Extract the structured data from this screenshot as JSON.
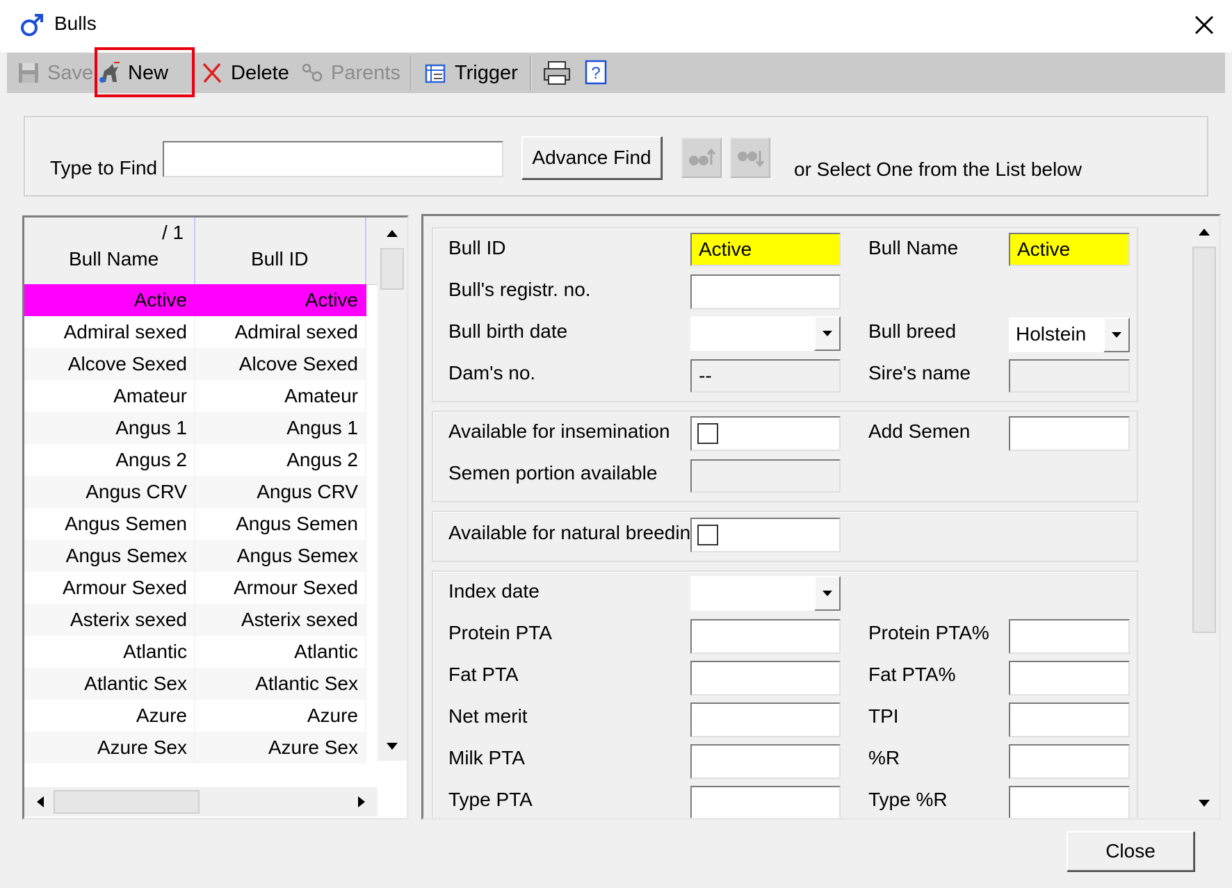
{
  "window": {
    "title": "Bulls",
    "close_glyph": "✕"
  },
  "toolbar": {
    "save": "Save",
    "new": "New",
    "delete": "Delete",
    "parents": "Parents",
    "trigger": "Trigger",
    "help_glyph": "?"
  },
  "find": {
    "label": "Type to Find",
    "value": "",
    "advance_find": "Advance Find",
    "hint": "or Select One from the List below"
  },
  "list": {
    "sort_indicator": "/ 1",
    "columns": [
      "Bull Name",
      "Bull ID"
    ],
    "rows": [
      [
        "Active",
        "Active"
      ],
      [
        "Admiral sexed",
        "Admiral sexed"
      ],
      [
        "Alcove Sexed",
        "Alcove Sexed"
      ],
      [
        "Amateur",
        "Amateur"
      ],
      [
        "Angus 1",
        "Angus 1"
      ],
      [
        "Angus 2",
        "Angus 2"
      ],
      [
        "Angus CRV",
        "Angus CRV"
      ],
      [
        "Angus Semen",
        "Angus Semen"
      ],
      [
        "Angus Semex",
        "Angus Semex"
      ],
      [
        "Armour Sexed",
        "Armour Sexed"
      ],
      [
        "Asterix sexed",
        "Asterix sexed"
      ],
      [
        "Atlantic",
        "Atlantic"
      ],
      [
        "Atlantic Sex",
        "Atlantic Sex"
      ],
      [
        "Azure",
        "Azure"
      ],
      [
        "Azure Sex",
        "Azure Sex"
      ]
    ],
    "selected_index": 0,
    "selected_color": "#ff00ff"
  },
  "detail": {
    "bull_id_label": "Bull ID",
    "bull_id_value": "Active",
    "bull_name_label": "Bull Name",
    "bull_name_value": "Active",
    "registr_label": "Bull's registr. no.",
    "registr_value": "",
    "birth_date_label": "Bull birth date",
    "birth_date_value": "",
    "breed_label": "Bull breed",
    "breed_value": "Holstein",
    "dams_no_label": "Dam's no.",
    "dams_no_value": "--",
    "sires_name_label": "Sire's name",
    "sires_name_value": "",
    "avail_insem_label": "Available for insemination",
    "add_semen_label": "Add Semen",
    "add_semen_value": "",
    "semen_portion_label": "Semen portion available",
    "semen_portion_value": "",
    "avail_natural_label": "Available for natural breeding",
    "index_date_label": "Index date",
    "index_date_value": "",
    "protein_pta_label": "Protein PTA",
    "protein_pta_pct_label": "Protein PTA%",
    "fat_pta_label": "Fat PTA",
    "fat_pta_pct_label": "Fat PTA%",
    "net_merit_label": "Net merit",
    "tpi_label": "TPI",
    "milk_pta_label": "Milk PTA",
    "pct_r_label": "%R",
    "type_pta_label": "Type PTA",
    "type_pct_r_label": "Type %R",
    "highlight_color": "#ffff00"
  },
  "footer": {
    "close": "Close"
  }
}
